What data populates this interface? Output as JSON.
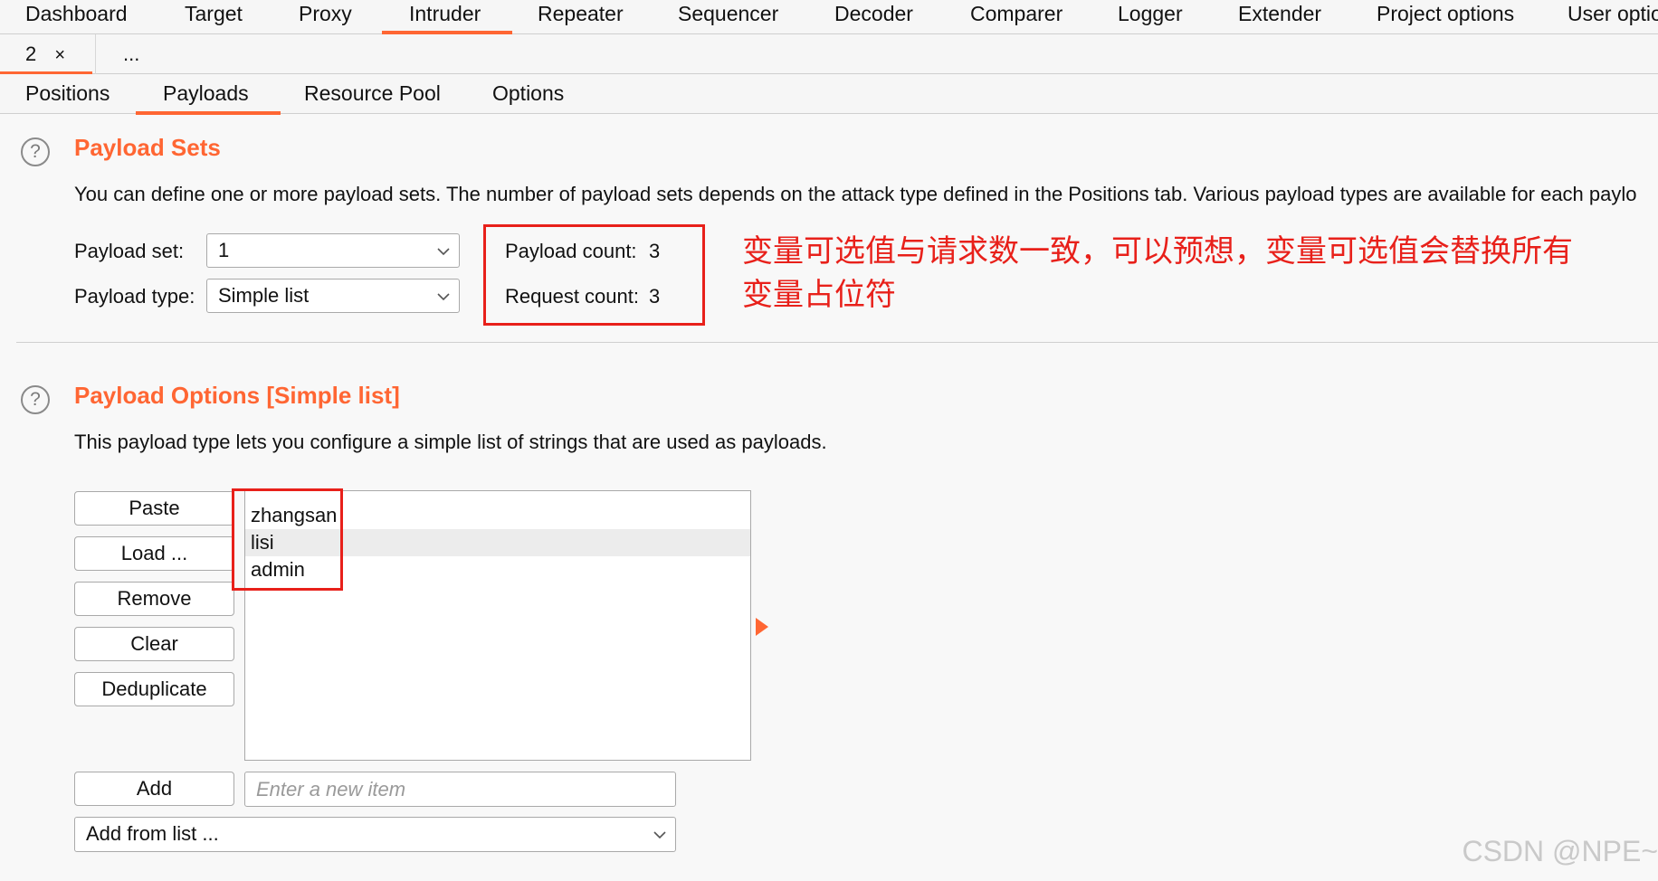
{
  "top_tabs": [
    "Dashboard",
    "Target",
    "Proxy",
    "Intruder",
    "Repeater",
    "Sequencer",
    "Decoder",
    "Comparer",
    "Logger",
    "Extender",
    "Project options",
    "User optio"
  ],
  "instance_tabs": {
    "current": "2",
    "close": "×",
    "more": "..."
  },
  "sub_tabs": [
    "Positions",
    "Payloads",
    "Resource Pool",
    "Options"
  ],
  "payload_sets": {
    "help": "?",
    "title": "Payload Sets",
    "description": "You can define one or more payload sets. The number of payload sets depends on the attack type defined in the Positions tab. Various payload types are available for each paylo",
    "set_label": "Payload set:",
    "set_value": "1",
    "type_label": "Payload type:",
    "type_value": "Simple list",
    "payload_count_label": "Payload count:",
    "payload_count": "3",
    "request_count_label": "Request count:",
    "request_count": "3"
  },
  "annotation": {
    "line1": "变量可选值与请求数一致，可以预想，变量可选值会替换所有",
    "line2": "变量占位符"
  },
  "payload_options": {
    "help": "?",
    "title": "Payload Options [Simple list]",
    "description": "This payload type lets you configure a simple list of strings that are used as payloads.",
    "buttons": {
      "paste": "Paste",
      "load": "Load ...",
      "remove": "Remove",
      "clear": "Clear",
      "deduplicate": "Deduplicate",
      "add": "Add"
    },
    "items": [
      "zhangsan",
      "lisi",
      "admin"
    ],
    "new_item_placeholder": "Enter a new item",
    "add_from_list": "Add from list ..."
  },
  "watermark": "CSDN @NPE~",
  "colors": {
    "accent": "#ff6633",
    "annotation": "#e8201a"
  }
}
